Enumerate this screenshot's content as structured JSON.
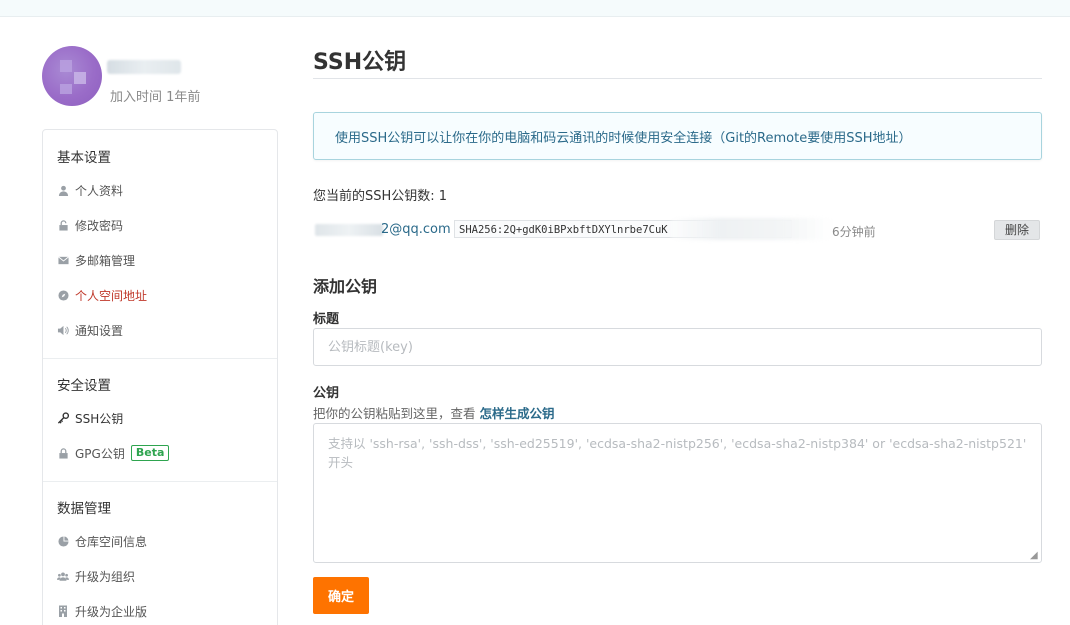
{
  "profile": {
    "join_time": "加入时间 1年前"
  },
  "sidebar": {
    "sections": [
      {
        "title": "基本设置",
        "items": [
          {
            "label": "个人资料",
            "icon": "user-icon"
          },
          {
            "label": "修改密码",
            "icon": "lock-open-icon"
          },
          {
            "label": "多邮箱管理",
            "icon": "envelope-icon"
          },
          {
            "label": "个人空间地址",
            "icon": "compass-icon"
          },
          {
            "label": "通知设置",
            "icon": "speaker-icon"
          }
        ]
      },
      {
        "title": "安全设置",
        "items": [
          {
            "label": "SSH公钥",
            "icon": "key-icon"
          },
          {
            "label": "GPG公钥",
            "icon": "lock-icon",
            "badge": "Beta"
          }
        ]
      },
      {
        "title": "数据管理",
        "items": [
          {
            "label": "仓库空间信息",
            "icon": "pie-chart-icon"
          },
          {
            "label": "升级为组织",
            "icon": "users-icon"
          },
          {
            "label": "升级为企业版",
            "icon": "building-icon"
          }
        ]
      }
    ]
  },
  "main": {
    "title": "SSH公钥",
    "info": "使用SSH公钥可以让你在你的电脑和码云通讯的时候使用安全连接（Git的Remote要使用SSH地址）",
    "key_count": "您当前的SSH公钥数: 1",
    "keys": [
      {
        "email_suffix": "2@qq.com",
        "fingerprint": "SHA256:2Q+gdK0iBPxbftDXYlnrbe7CuK",
        "time": "6分钟前",
        "delete_label": "删除"
      }
    ],
    "add_title": "添加公钥",
    "title_label": "标题",
    "title_placeholder": "公钥标题(key)",
    "key_label": "公钥",
    "key_hint": "把你的公钥粘贴到这里，查看",
    "key_hint_link": "怎样生成公钥",
    "key_placeholder": "支持以 'ssh-rsa', 'ssh-dss', 'ssh-ed25519', 'ecdsa-sha2-nistp256', 'ecdsa-sha2-nistp384' or 'ecdsa-sha2-nistp521' 开头",
    "submit_label": "确定"
  },
  "colors": {
    "accent_orange": "#fe7300",
    "link_blue": "#2b6a8a",
    "beta_green": "#2ea44f",
    "warning_red": "#c0392b"
  }
}
